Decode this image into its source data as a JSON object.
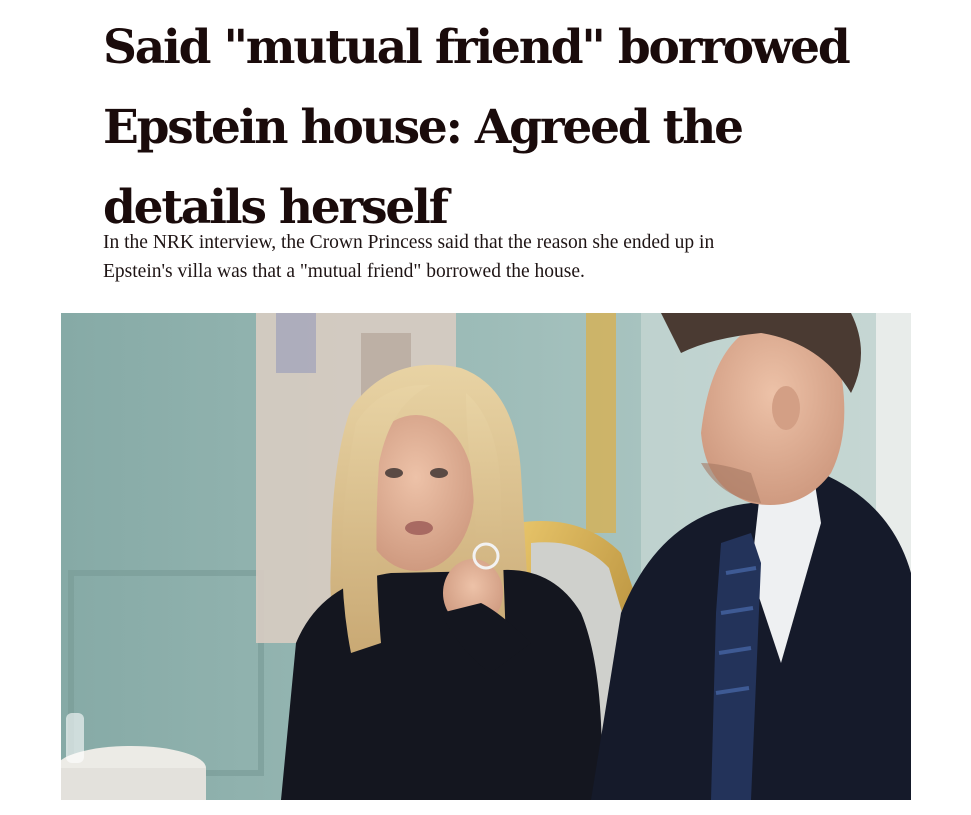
{
  "article": {
    "headline_lines": [
      "Said \"mutual friend\" borrowed",
      "Epstein house: Agreed the",
      "details herself"
    ],
    "lede_lines": [
      "In the NRK interview, the Crown Princess said that the reason she ended up in",
      "Epstein's villa was that a \"mutual friend\" borrowed the house."
    ]
  },
  "photo": {
    "subjects": [
      "woman-blonde-dark-sweater",
      "man-dark-suit-blue-tie"
    ],
    "palette": {
      "wall": "#8fb2ae",
      "panel": "#d9cfc6",
      "hair": "#d9c08f",
      "skin": "#e2b39a",
      "sweater": "#14161f",
      "suit": "#151a2a",
      "tie": "#23335a",
      "chair_gold": "#c8a24a"
    }
  }
}
